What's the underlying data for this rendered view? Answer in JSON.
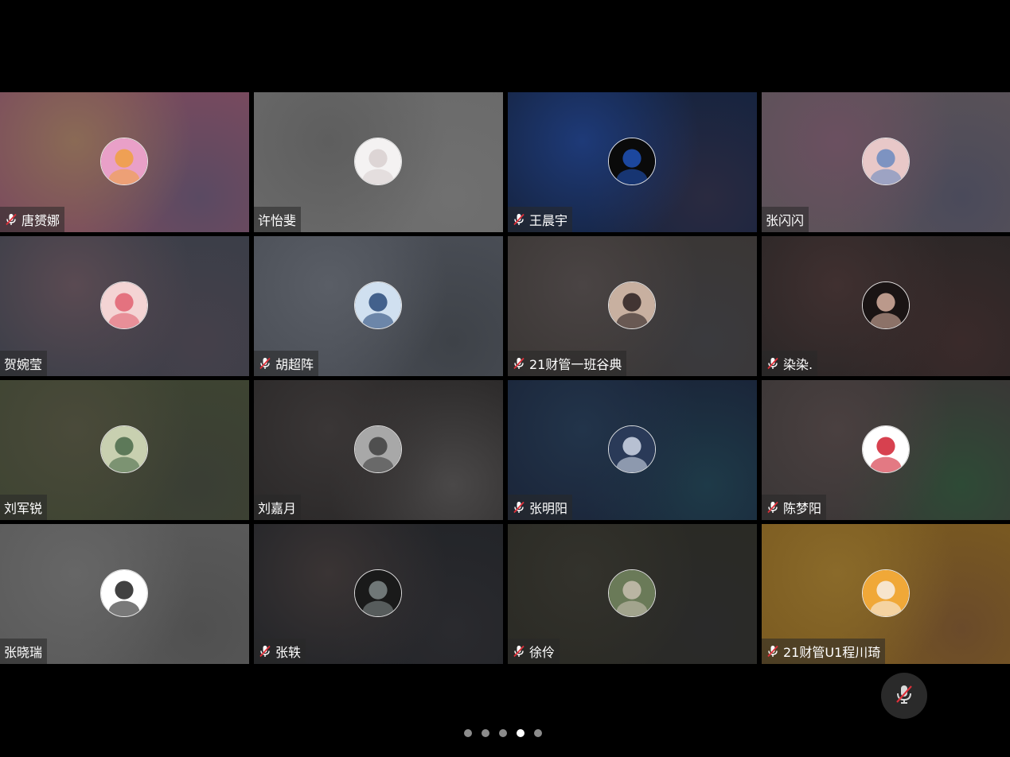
{
  "participants": [
    {
      "name": "唐赟娜",
      "muted": true,
      "bg": [
        "#7a4a5e",
        "#8a6a55",
        "#5a4a62"
      ],
      "avatar": "tiger-avatar",
      "avatar_colors": [
        "#e9a0c8",
        "#f0a040"
      ]
    },
    {
      "name": "许怡斐",
      "muted": false,
      "bg": [
        "#6a6a6a",
        "#5e5e5e",
        "#707070"
      ],
      "avatar": "sketch-avatar",
      "avatar_colors": [
        "#f4f2f2",
        "#d8d0d0"
      ]
    },
    {
      "name": "王晨宇",
      "muted": true,
      "bg": [
        "#15233f",
        "#1e3a78",
        "#2a2a40"
      ],
      "avatar": "screen-avatar",
      "avatar_colors": [
        "#0a0a0a",
        "#2052b8"
      ]
    },
    {
      "name": "张闪闪",
      "muted": false,
      "bg": [
        "#5a5258",
        "#6b5060",
        "#4a4a5a"
      ],
      "avatar": "anime-boy-avatar",
      "avatar_colors": [
        "#e8c8c8",
        "#6a8ac0"
      ]
    },
    {
      "name": "贺婉莹",
      "muted": false,
      "bg": [
        "#3a3e48",
        "#5a4a52",
        "#45404a"
      ],
      "avatar": "cartoon-girl-avatar",
      "avatar_colors": [
        "#f4d4d4",
        "#e06070"
      ]
    },
    {
      "name": "胡超阵",
      "muted": true,
      "bg": [
        "#4a4e56",
        "#5a5e66",
        "#3e4248"
      ],
      "avatar": "anime-blue-avatar",
      "avatar_colors": [
        "#d0e0f0",
        "#2a4a7a"
      ]
    },
    {
      "name": "21财管一班谷典",
      "muted": true,
      "bg": [
        "#3a3634",
        "#4a4444",
        "#3a3a3e"
      ],
      "avatar": "photo-girl-avatar",
      "avatar_colors": [
        "#c8b0a0",
        "#2a2020"
      ]
    },
    {
      "name": "染染.",
      "muted": true,
      "bg": [
        "#2a2626",
        "#403030",
        "#3a2a2a"
      ],
      "avatar": "dark-hair-avatar",
      "avatar_colors": [
        "#1a1414",
        "#d8b0a0"
      ]
    },
    {
      "name": "刘军锐",
      "muted": false,
      "bg": [
        "#3e4432",
        "#4a4a3a",
        "#3a3e34"
      ],
      "avatar": "anime-green-avatar",
      "avatar_colors": [
        "#c8d0b0",
        "#4a6a4a"
      ]
    },
    {
      "name": "刘嘉月",
      "muted": false,
      "bg": [
        "#2a2828",
        "#3a3636",
        "#4a4848"
      ],
      "avatar": "dog-avatar",
      "avatar_colors": [
        "#a8a8a8",
        "#404040"
      ]
    },
    {
      "name": "张明阳",
      "muted": true,
      "bg": [
        "#1a2438",
        "#22344a",
        "#1e3a48"
      ],
      "avatar": "anime-dark-avatar",
      "avatar_colors": [
        "#2a3a58",
        "#d0d8e8"
      ]
    },
    {
      "name": "陈梦阳",
      "muted": true,
      "bg": [
        "#3a3636",
        "#4a4040",
        "#2e4a36"
      ],
      "avatar": "red-bow-avatar",
      "avatar_colors": [
        "#ffffff",
        "#d02030"
      ]
    },
    {
      "name": "张晓瑞",
      "muted": false,
      "bg": [
        "#5a5a5a",
        "#666666",
        "#505050"
      ],
      "avatar": "calligraphy-avatar",
      "avatar_colors": [
        "#ffffff",
        "#202020"
      ]
    },
    {
      "name": "张轶",
      "muted": true,
      "bg": [
        "#222428",
        "#3a3434",
        "#2a2a2e"
      ],
      "avatar": "photo-boy-avatar",
      "avatar_colors": [
        "#1a1a1a",
        "#808888"
      ]
    },
    {
      "name": "徐伶",
      "muted": true,
      "bg": [
        "#2a2a24",
        "#33322c",
        "#2a2a2a"
      ],
      "avatar": "landscape-avatar",
      "avatar_colors": [
        "#6a7a58",
        "#c8c0b0"
      ]
    },
    {
      "name": "21财管U1程川琦",
      "muted": true,
      "bg": [
        "#7a5a20",
        "#8a6a2a",
        "#6a4a2a"
      ],
      "avatar": "sheep-avatar",
      "avatar_colors": [
        "#f0a838",
        "#f8f0e8"
      ]
    }
  ],
  "controls": {
    "mute_all_icon": "mic-off-icon",
    "muted_icon_color": "#e0303a"
  },
  "pager": {
    "total_pages": 5,
    "current_page": 4
  }
}
